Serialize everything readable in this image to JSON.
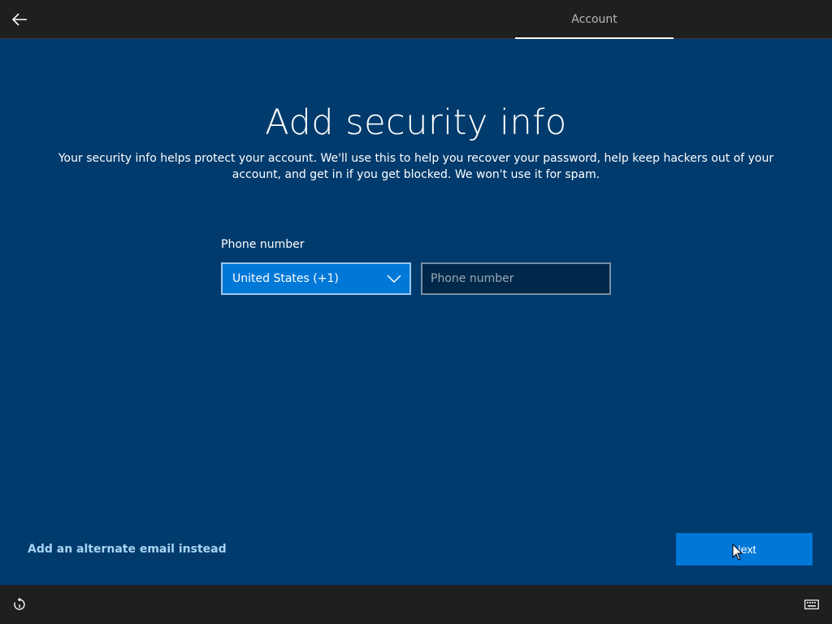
{
  "header": {
    "back_icon": "arrow-left-icon",
    "active_tab": "Account"
  },
  "main": {
    "title": "Add security info",
    "description": "Your security info helps protect your account. We'll use this to help you recover your password, help keep hackers out of your account, and get in if you get blocked. We won't use it for spam.",
    "phone_label": "Phone number",
    "country_select": {
      "selected": "United States (+1)",
      "icon": "chevron-down-icon"
    },
    "phone_input": {
      "value": "",
      "placeholder": "Phone number"
    },
    "alt_email_link": "Add an alternate email instead",
    "next_label": "Next"
  },
  "footer": {
    "ease_of_access_icon": "ease-of-access-icon",
    "keyboard_icon": "keyboard-icon"
  },
  "colors": {
    "background": "#013b6d",
    "accent": "#0078d7",
    "bar": "#1f1f1f",
    "link": "#a8d4f5"
  }
}
